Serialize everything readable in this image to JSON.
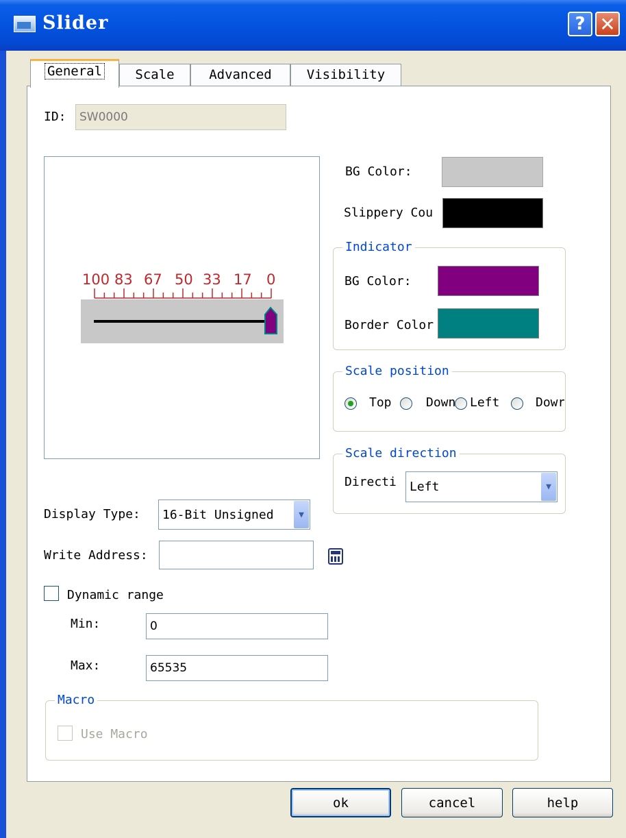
{
  "window": {
    "title": "Slider"
  },
  "tabs": [
    "General",
    "Scale",
    "Advanced",
    "Visibility"
  ],
  "general": {
    "id_label": "ID:",
    "id_value": "SW0000",
    "bg_color_label": "BG Color:",
    "slippery_color_label": "Slippery Cou",
    "indicator": {
      "title": "Indicator",
      "bg_color_label": "BG Color:",
      "border_color_label": "Border Color"
    },
    "scale_position": {
      "title": "Scale position",
      "options": [
        "Top",
        "Down",
        "Left",
        "Dowr"
      ],
      "selected": "Top"
    },
    "scale_direction": {
      "title": "Scale direction",
      "direction_label": "Directi",
      "direction_value": "Left"
    },
    "display_type_label": "Display Type:",
    "display_type_value": "16-Bit Unsigned",
    "write_address_label": "Write Address:",
    "write_address_value": "",
    "dynamic_range_label": "Dynamic range",
    "dynamic_range_checked": false,
    "min_label": "Min:",
    "min_value": "0",
    "max_label": "Max:",
    "max_value": "65535",
    "macro": {
      "title": "Macro",
      "use_macro_label": "Use Macro",
      "checked": false
    }
  },
  "preview": {
    "scale_labels": [
      "100",
      "83",
      "67",
      "50",
      "33",
      "17",
      "0"
    ],
    "value": 0
  },
  "colors": {
    "bg_color": "#c8c8c8",
    "slippery_color": "#000000",
    "indicator_bg": "#800080",
    "indicator_border": "#008080",
    "scale_color": "#c0282d"
  },
  "buttons": {
    "ok": "ok",
    "cancel": "cancel",
    "help": "help"
  }
}
